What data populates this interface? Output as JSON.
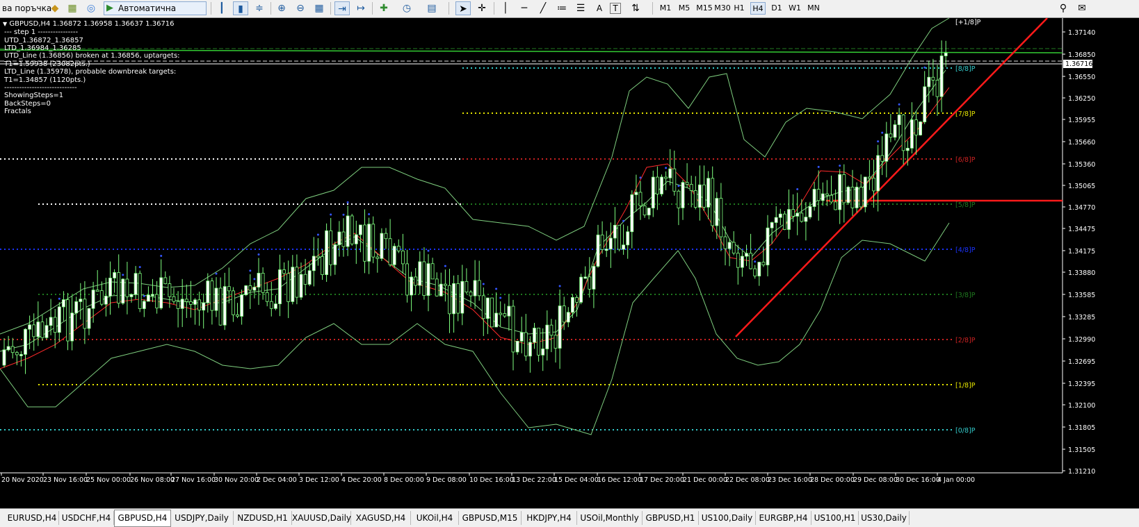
{
  "toolbar": {
    "order_label": "ва поръчка",
    "autotrading_label": "Автоматична търговия",
    "timeframes": [
      "M1",
      "M5",
      "M15",
      "M30",
      "H1",
      "H4",
      "D1",
      "W1",
      "MN"
    ],
    "active_timeframe": "H4",
    "text_tool": "A",
    "text_label_tool": "T"
  },
  "chart": {
    "header": "GBPUSD,H4  1.36872 1.36958 1.36637 1.36716",
    "info_lines": [
      "---  step 1  ----------------",
      "UTD_1.36872_1.36857",
      "LTD_1.36984_1.36285",
      "UTD_Line (1.36856) broken at 1.36856, uptargets:",
      "T1=1.59938 (23082pts.)",
      "LTD_Line (1.35978), probable downbreak targets:",
      "T1=1.34857 (1120pts.)",
      "-----------------------------",
      "ShowingSteps=1",
      "BackSteps=0",
      "Fractals"
    ],
    "price_labels": [
      "1.37140",
      "1.36850",
      "1.36716",
      "1.36550",
      "1.36250",
      "1.35955",
      "1.35660",
      "1.35360",
      "1.35065",
      "1.34770",
      "1.34475",
      "1.34175",
      "1.33880",
      "1.33585",
      "1.33285",
      "1.32990",
      "1.32695",
      "1.32395",
      "1.32100",
      "1.31805",
      "1.31505",
      "1.31210"
    ],
    "current_price": "1.36716",
    "time_labels": [
      "20 Nov 2020",
      "23 Nov 16:00",
      "25 Nov 00:00",
      "26 Nov 08:00",
      "27 Nov 16:00",
      "30 Nov 20:00",
      "2 Dec 04:00",
      "3 Dec 12:00",
      "4 Dec 20:00",
      "8 Dec 00:00",
      "9 Dec 08:00",
      "10 Dec 16:00",
      "13 Dec 22:00",
      "15 Dec 04:00",
      "16 Dec 12:00",
      "17 Dec 20:00",
      "21 Dec 00:00",
      "22 Dec 08:00",
      "23 Dec 16:00",
      "28 Dec 00:00",
      "29 Dec 08:00",
      "30 Dec 16:00",
      "4 Jan 00:00"
    ],
    "murrey_labels": [
      {
        "label": "[+1/8]P",
        "color": "#ffffff"
      },
      {
        "label": "[8/8]P",
        "color": "#33cccc"
      },
      {
        "label": "[7/8]P",
        "color": "#e6e600"
      },
      {
        "label": "[6/8]P",
        "color": "#cc2222"
      },
      {
        "label": "[5/8]P",
        "color": "#1f7a1f"
      },
      {
        "label": "[4/8]P",
        "color": "#1a33ff"
      },
      {
        "label": "[3/8]P",
        "color": "#1f7a1f"
      },
      {
        "label": "[2/8]P",
        "color": "#cc2222"
      },
      {
        "label": "[1/8]P",
        "color": "#e6e600"
      },
      {
        "label": "[0/8]P",
        "color": "#33cccc"
      }
    ]
  },
  "bottom_tabs": [
    "EURUSD,H4",
    "USDCHF,H4",
    "GBPUSD,H4",
    "USDJPY,Daily",
    "NZDUSD,H1",
    "XAUUSD,Daily",
    "XAGUSD,H4",
    "UKOil,H4",
    "GBPUSD,M15",
    "HKDJPY,H4",
    "USOil,Monthly",
    "GBPUSD,H1",
    "US100,Daily",
    "EURGBP,H4",
    "US100,H1",
    "US30,Daily"
  ],
  "active_tab": "GBPUSD,H4"
}
